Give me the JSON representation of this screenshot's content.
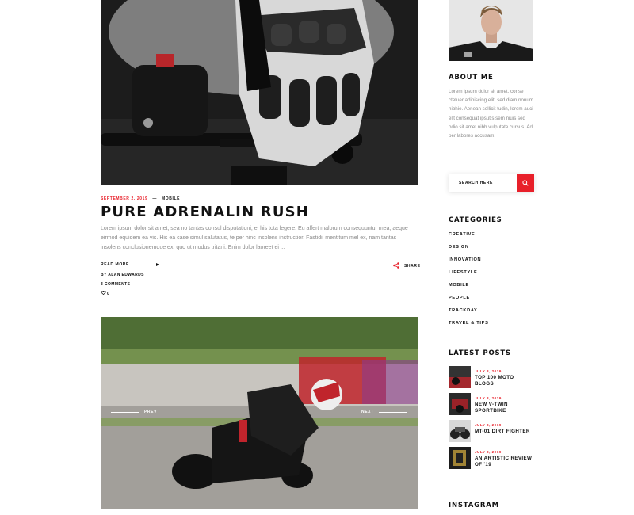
{
  "post": {
    "date": "SEPTEMBER 2, 2019",
    "dash": "—",
    "category": "MOBILE",
    "title": "PURE ADRENALIN RUSH",
    "excerpt": "Lorem ipsum dolor sit amet, sea no tantas consul disputationi, ei his tota legere. Eu affert malorum consequuntur mea, aeque eirmod equidem ea vis. His ea case simul salutatus, te per hinc insolens instructior. Fastidii mentitum mel ex, nam tantas insolens conclusionemque ex, quo ut modus tritani. Enim dolor laoreet ei ...",
    "read_more": "READ MORE",
    "share": "SHARE",
    "byline": "BY ALAN EDWARDS",
    "comments": "3 COMMENTS",
    "likes": "0"
  },
  "slider": {
    "prev": "PREV",
    "next": "NEXT"
  },
  "sidebar": {
    "about_title": "ABOUT ME",
    "about_text": "Lorem ipsum dolor sit amet, conse ctetuer adipiscing elit, sed diam nonum nibhie. Aenean sollicit tudin, lorem auci elit consequat ipsutis sem niuis sed odio sit amet nibh vulputate cursus. Ad per labores accusam.",
    "search_placeholder": "SEARCH HERE",
    "categories_title": "CATEGORIES",
    "categories": [
      "CREATIVE",
      "DESIGN",
      "INNOVATION",
      "LIFESTYLE",
      "MOBILE",
      "PEOPLE",
      "TRACKDAY",
      "TRAVEL & TIPS"
    ],
    "latest_title": "LATEST POSTS",
    "latest": [
      {
        "date": "JULY 3, 2019",
        "title": "TOP 100 MOTO BLOGS"
      },
      {
        "date": "JULY 3, 2019",
        "title": "NEW V-TWIN SPORTBIKE"
      },
      {
        "date": "JULY 3, 2019",
        "title": "MT-01 DIRT FIGHTER"
      },
      {
        "date": "JULY 3, 2019",
        "title": "AN ARTISTIC REVIEW OF '19"
      }
    ],
    "instagram_title": "INSTAGRAM"
  },
  "colors": {
    "accent": "#e8202a",
    "text": "#111111",
    "muted": "#8a8a8a"
  },
  "icons": {
    "share": "share-icon",
    "likes": "heart-icon",
    "search": "search-icon",
    "prev": "arrow-left-icon",
    "next": "arrow-right-icon"
  }
}
